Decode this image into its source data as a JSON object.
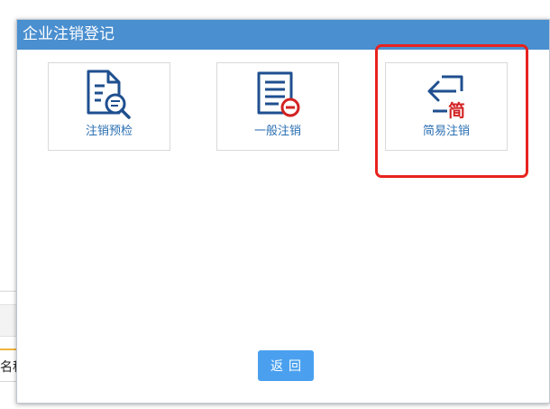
{
  "background": {
    "partial_label": "名称"
  },
  "dialog": {
    "title": "企业注销登记",
    "options": [
      {
        "label": "注销预检",
        "icon": "document-search-icon"
      },
      {
        "label": "一般注销",
        "icon": "document-minus-icon"
      },
      {
        "label": "简易注销",
        "icon": "exit-arrow-simple-icon",
        "badge": "简"
      }
    ],
    "back_label": "返回"
  },
  "colors": {
    "header": "#4a8fcf",
    "icon": "#1f4f8f",
    "label": "#2a6fb2",
    "button": "#4aa0ef",
    "highlight": "#e8231e",
    "alert": "#d32222"
  }
}
